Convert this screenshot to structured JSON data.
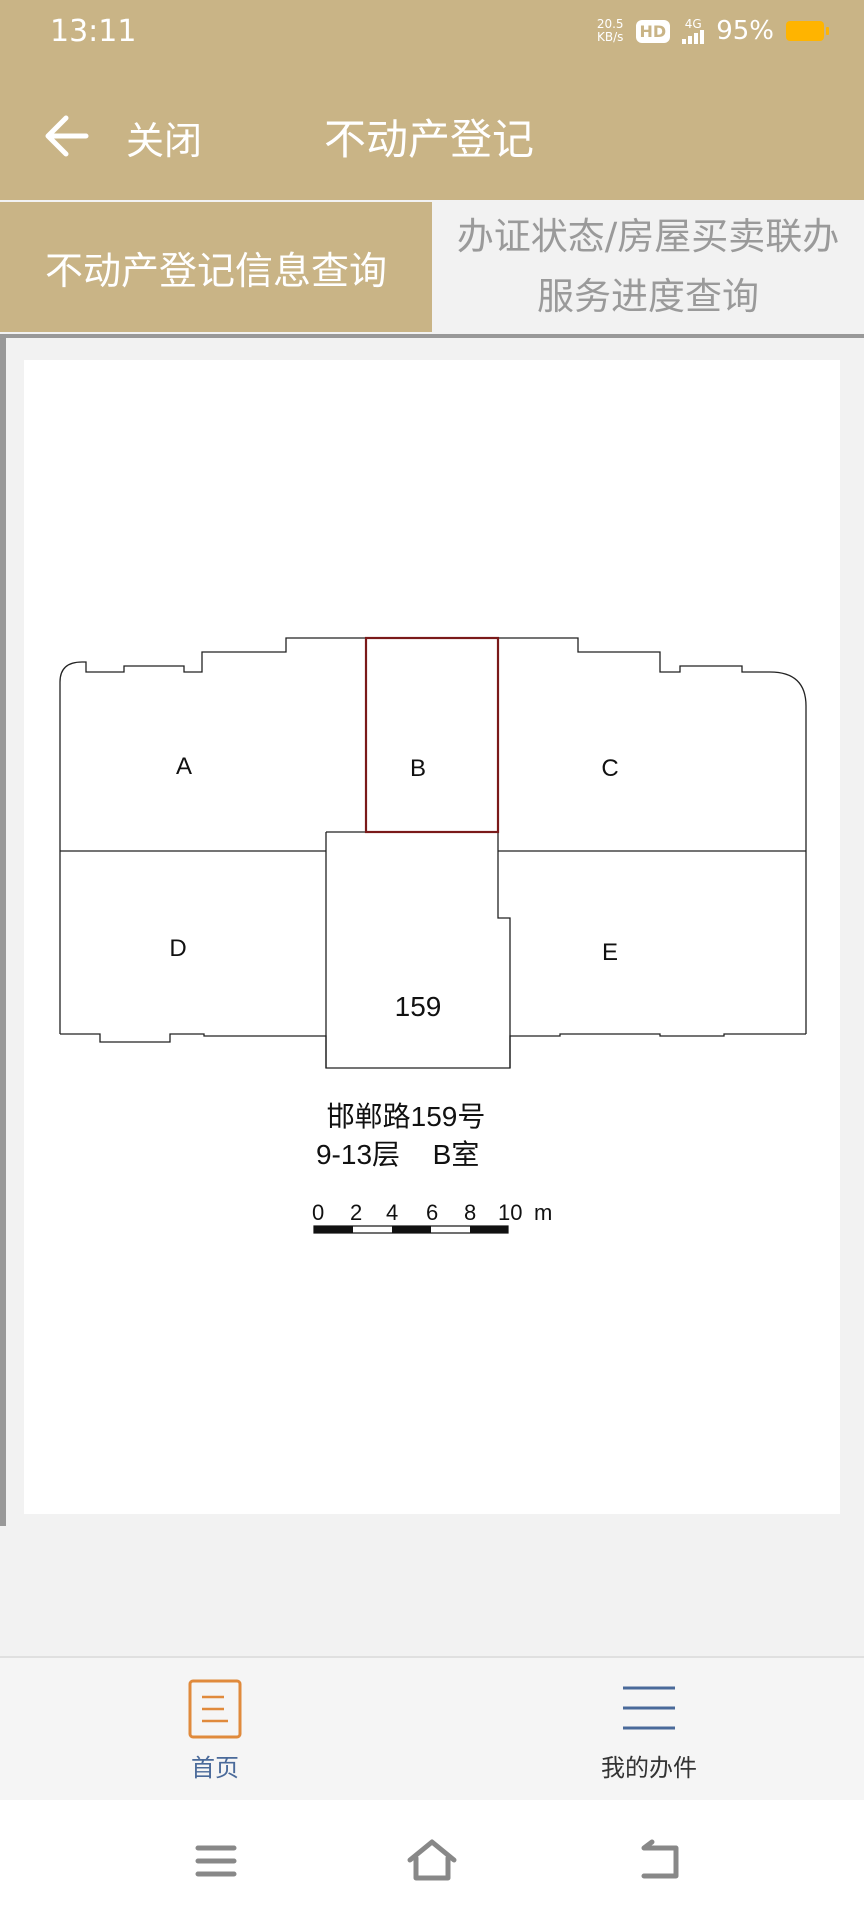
{
  "status_bar": {
    "time": "13:11",
    "net_speed_value": "20.5",
    "net_speed_unit": "KB/s",
    "hd": "HD",
    "network": "4G",
    "battery": "95%",
    "battery_color": "#ffb400"
  },
  "header": {
    "close_label": "关闭",
    "title": "不动产登记",
    "background": "#c9b486"
  },
  "tabs": {
    "active_label": "不动产登记信息查询",
    "inactive_line1": "办证状态/房屋买卖联办",
    "inactive_line2": "服务进度查询"
  },
  "floor_plan": {
    "units": [
      "A",
      "B",
      "C",
      "D",
      "E"
    ],
    "selected_unit": "B",
    "core_label": "159",
    "address": "邯郸路159号",
    "floors": "9-13层",
    "room": "B室",
    "scale_ticks": [
      "0",
      "2",
      "4",
      "6",
      "8",
      "10"
    ],
    "scale_unit": "m",
    "selected_color": "#7a1a1a"
  },
  "bottom_nav": {
    "home_label": "首页",
    "mine_label": "我的办件",
    "active_color": "#4a6a9a",
    "home_icon_color": "#e08a3c"
  },
  "icons": {
    "back": "arrow-left-icon",
    "home": "document-icon",
    "mine": "menu-lines-icon",
    "sys_menu": "hamburger-icon",
    "sys_home": "home-icon",
    "sys_back": "back-icon"
  }
}
